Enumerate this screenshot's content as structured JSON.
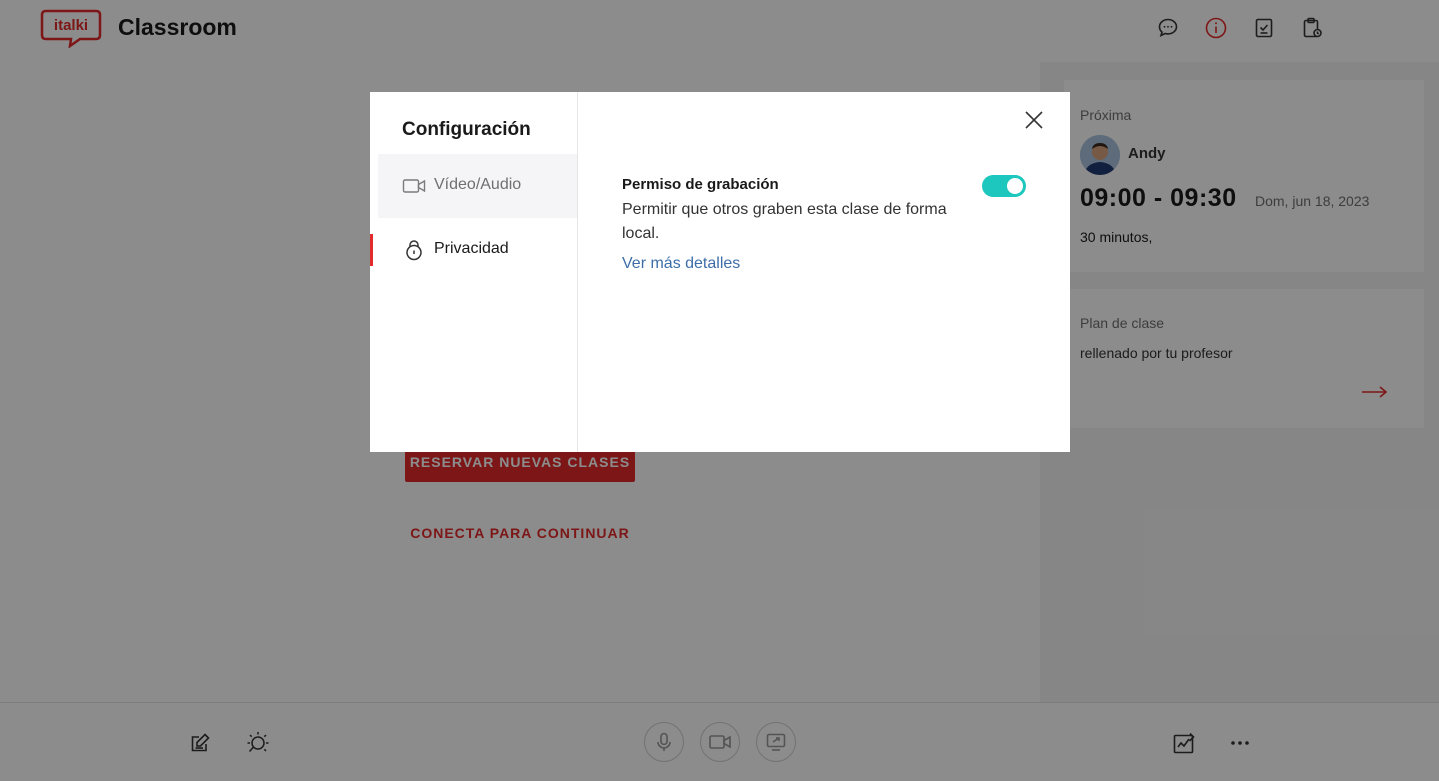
{
  "header": {
    "logo_text": "italki",
    "title": "Classroom"
  },
  "right_panel": {
    "tabs": [
      "chat-icon",
      "info-icon",
      "checklist-icon",
      "clipboard-icon"
    ],
    "next_lesson": {
      "label": "Próxima",
      "teacher": "Andy",
      "time": "09:00 - 09:30",
      "date": "Dom, jun 18, 2023",
      "duration": "30 minutos,"
    },
    "lesson_plan": {
      "label": "Plan de clase",
      "desc": "rellenado por tu profesor"
    }
  },
  "main": {
    "book_button": "RESERVAR NUEVAS CLASES",
    "connect_link": "CONECTA PARA CONTINUAR"
  },
  "bottom_bar": {
    "left_icons": [
      "notes-icon",
      "lightbulb-icon"
    ],
    "center_icons": [
      "microphone-icon",
      "camera-icon",
      "screen-share-icon"
    ],
    "right_icons": [
      "signature-icon",
      "more-icon"
    ]
  },
  "modal": {
    "title": "Configuración",
    "menu": [
      {
        "label": "Vídeo/Audio",
        "icon": "video-camera-icon"
      },
      {
        "label": "Privacidad",
        "icon": "lock-icon"
      }
    ],
    "setting": {
      "title": "Permiso de grabación",
      "description": "Permitir que otros graben esta clase de forma local.",
      "link": "Ver más detalles",
      "enabled": true
    }
  },
  "colors": {
    "brand_red": "#e32b2b",
    "toggle_on": "#1ec7be",
    "link_blue": "#3d6ea8"
  }
}
